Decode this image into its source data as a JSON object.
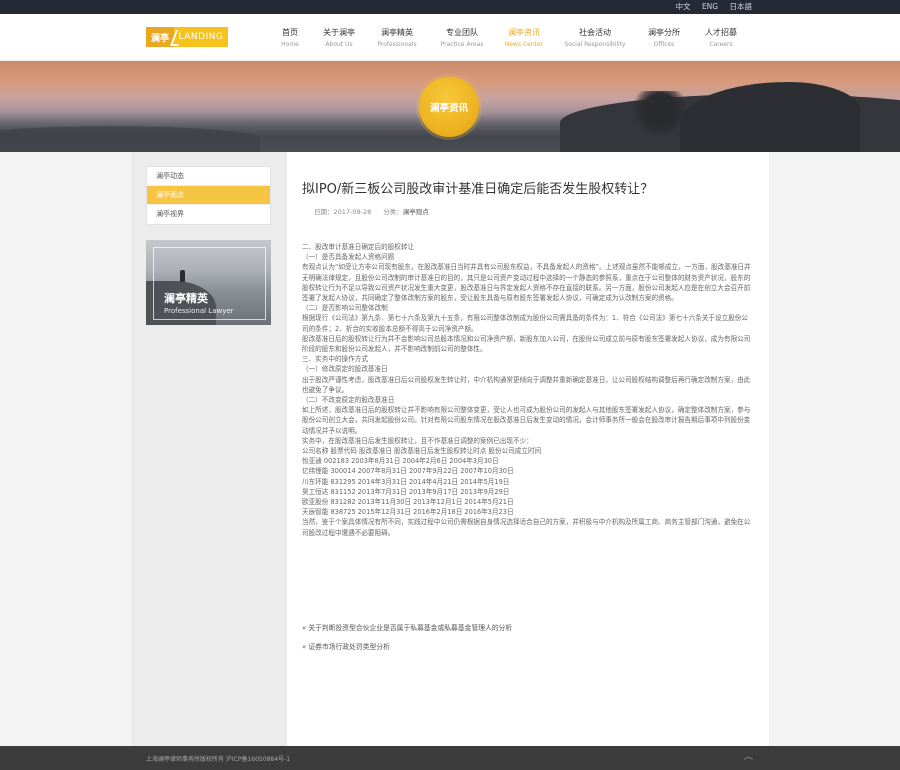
{
  "lang": [
    "中文",
    "ENG",
    "日本語"
  ],
  "logo": {
    "part1": "澜亭",
    "part2": "LANDING"
  },
  "nav": [
    {
      "zh": "首页",
      "en": "Home"
    },
    {
      "zh": "关于澜亭",
      "en": "About Us"
    },
    {
      "zh": "澜亭精英",
      "en": "Professionals"
    },
    {
      "zh": "专业团队",
      "en": "Practice Areas"
    },
    {
      "zh": "澜亭资讯",
      "en": "News Center"
    },
    {
      "zh": "社会活动",
      "en": "Social Responsibility"
    },
    {
      "zh": "澜亭分所",
      "en": "Offices"
    },
    {
      "zh": "人才招募",
      "en": "Careers"
    }
  ],
  "nav_active_index": 4,
  "banner": {
    "badge": "澜亭资讯"
  },
  "sidebar": {
    "items": [
      "澜亭动态",
      "澜亭观点",
      "澜亭视界"
    ],
    "active_index": 1,
    "promo": {
      "title": "澜亭精英",
      "subtitle": "Professional Lawyer"
    }
  },
  "article": {
    "title": "拟IPO/新三板公司股改审计基准日确定后能否发生股权转让？",
    "date_label": "日期：2017-09-28",
    "category_label": "分类：",
    "category": "澜亭观点",
    "paragraphs": [
      "二、股改审计基准日确定后的股权转让",
      "（一）是否具备发起人资格问题",
      "有观点认为“如受让方非公司现有股东，在股改基准日当时并具有公司股东权益，不具备发起人的资格”。上述观点虽然不能够成立，一方面，股改基准日并无明确法律规定，且股份公司改制的审计基准日的目的，其只是公司资产变动过程中选择的一个静态的参照系，重点在于公司整体的财务资产状况，股东的股权转让行为不足以导致公司资产状况发生重大变更，股改基准日与界定发起人资格不存在直接的联系。另一方面，股份公司发起人应是在创立大会召开前签署了发起人协议，共同确定了整体改制方案的股东，受让股东具备与原有股东签署发起人协议，可确定成为认改制方案的资格。",
      "（二）是否影响公司整体改制",
      "根据现行《公司法》第九条、第七十六条及第九十五条，有限公司整体改制成为股份公司需具备的条件为：1、符合《公司法》第七十六条关于设立股份公司的条件；2、折合的实收股本总额不得高于公司净资产额。",
      "股改基准日后的股权转让行为并不会影响公司总股本情况和公司净资产额，新股东加入公司，在股份公司成立前与原有股东签署发起人协议，成为有限公司阶段的股东和股份公司发起人，并不影响改制前公司的整体性。",
      "三、实务中的操作方式",
      "（一）修改原定的股改基准日",
      "出于股改严谨性考虑，股改基准日后公司股权发生转让时，中介机构通常更倾向于调整并重新确定基准日，让公司股权结构调整后再行确定改制方案，由此也避免了争议。",
      "（二）不改变原定的股改基准日",
      "如上所述，股改基准日后的股权转让并不影响有限公司整体变更，受让人也可成为股份公司的发起人与其他股东签署发起人协议，确定整体改制方案，参与股份公司创立大会，共同发起股份公司。针对有限公司股东情况在股改基准日后发生变动的情况，会计师事务所一般会在股改审计报告期后事项中列股份变动情况并予以说明。",
      "实务中，在股改基准日后发生股权转让，且不作基准日调整的案例已出现不少：",
      "公司名称 股票代码 股改基准日 股改基准日后发生股权转让时点 股份公司成立时间",
      "怡亚通 002183 2003年8月31日 2004年2月6日 2004年3月30日",
      "亿纬锂能 300014 2007年8月31日 2007年9月22日 2007年10月30日",
      "川东环能 831295 2014年3月31日 2014年4月21日 2014年5月19日",
      "昊工恒达 831152 2013年7月31日 2013年9月17日 2013年9月29日",
      "欧亚股份 831282 2013年11月30日 2013年12月1日 2014年5月21日",
      "天辰智能 838725 2015年12月31日 2016年2月18日 2016年3月23日",
      "当然，鉴于个案具体情况有所不同，实践过程中公司仍需根据自身情况选择适合自己的方案，并积极与中介机构及所属工商、商务主管部门沟通，避免在公司股改过程中遭遇不必要阻碍。"
    ],
    "prev": "« 关于判断投资型合伙企业是否属于私募基金或私募基金管理人的分析",
    "next": "» 证券市场行政处罚类型分析"
  },
  "footer": {
    "copyright": "上海澜亭律师事务所版权所有 沪ICP备16050884号-1",
    "back_to_top": "︿"
  }
}
